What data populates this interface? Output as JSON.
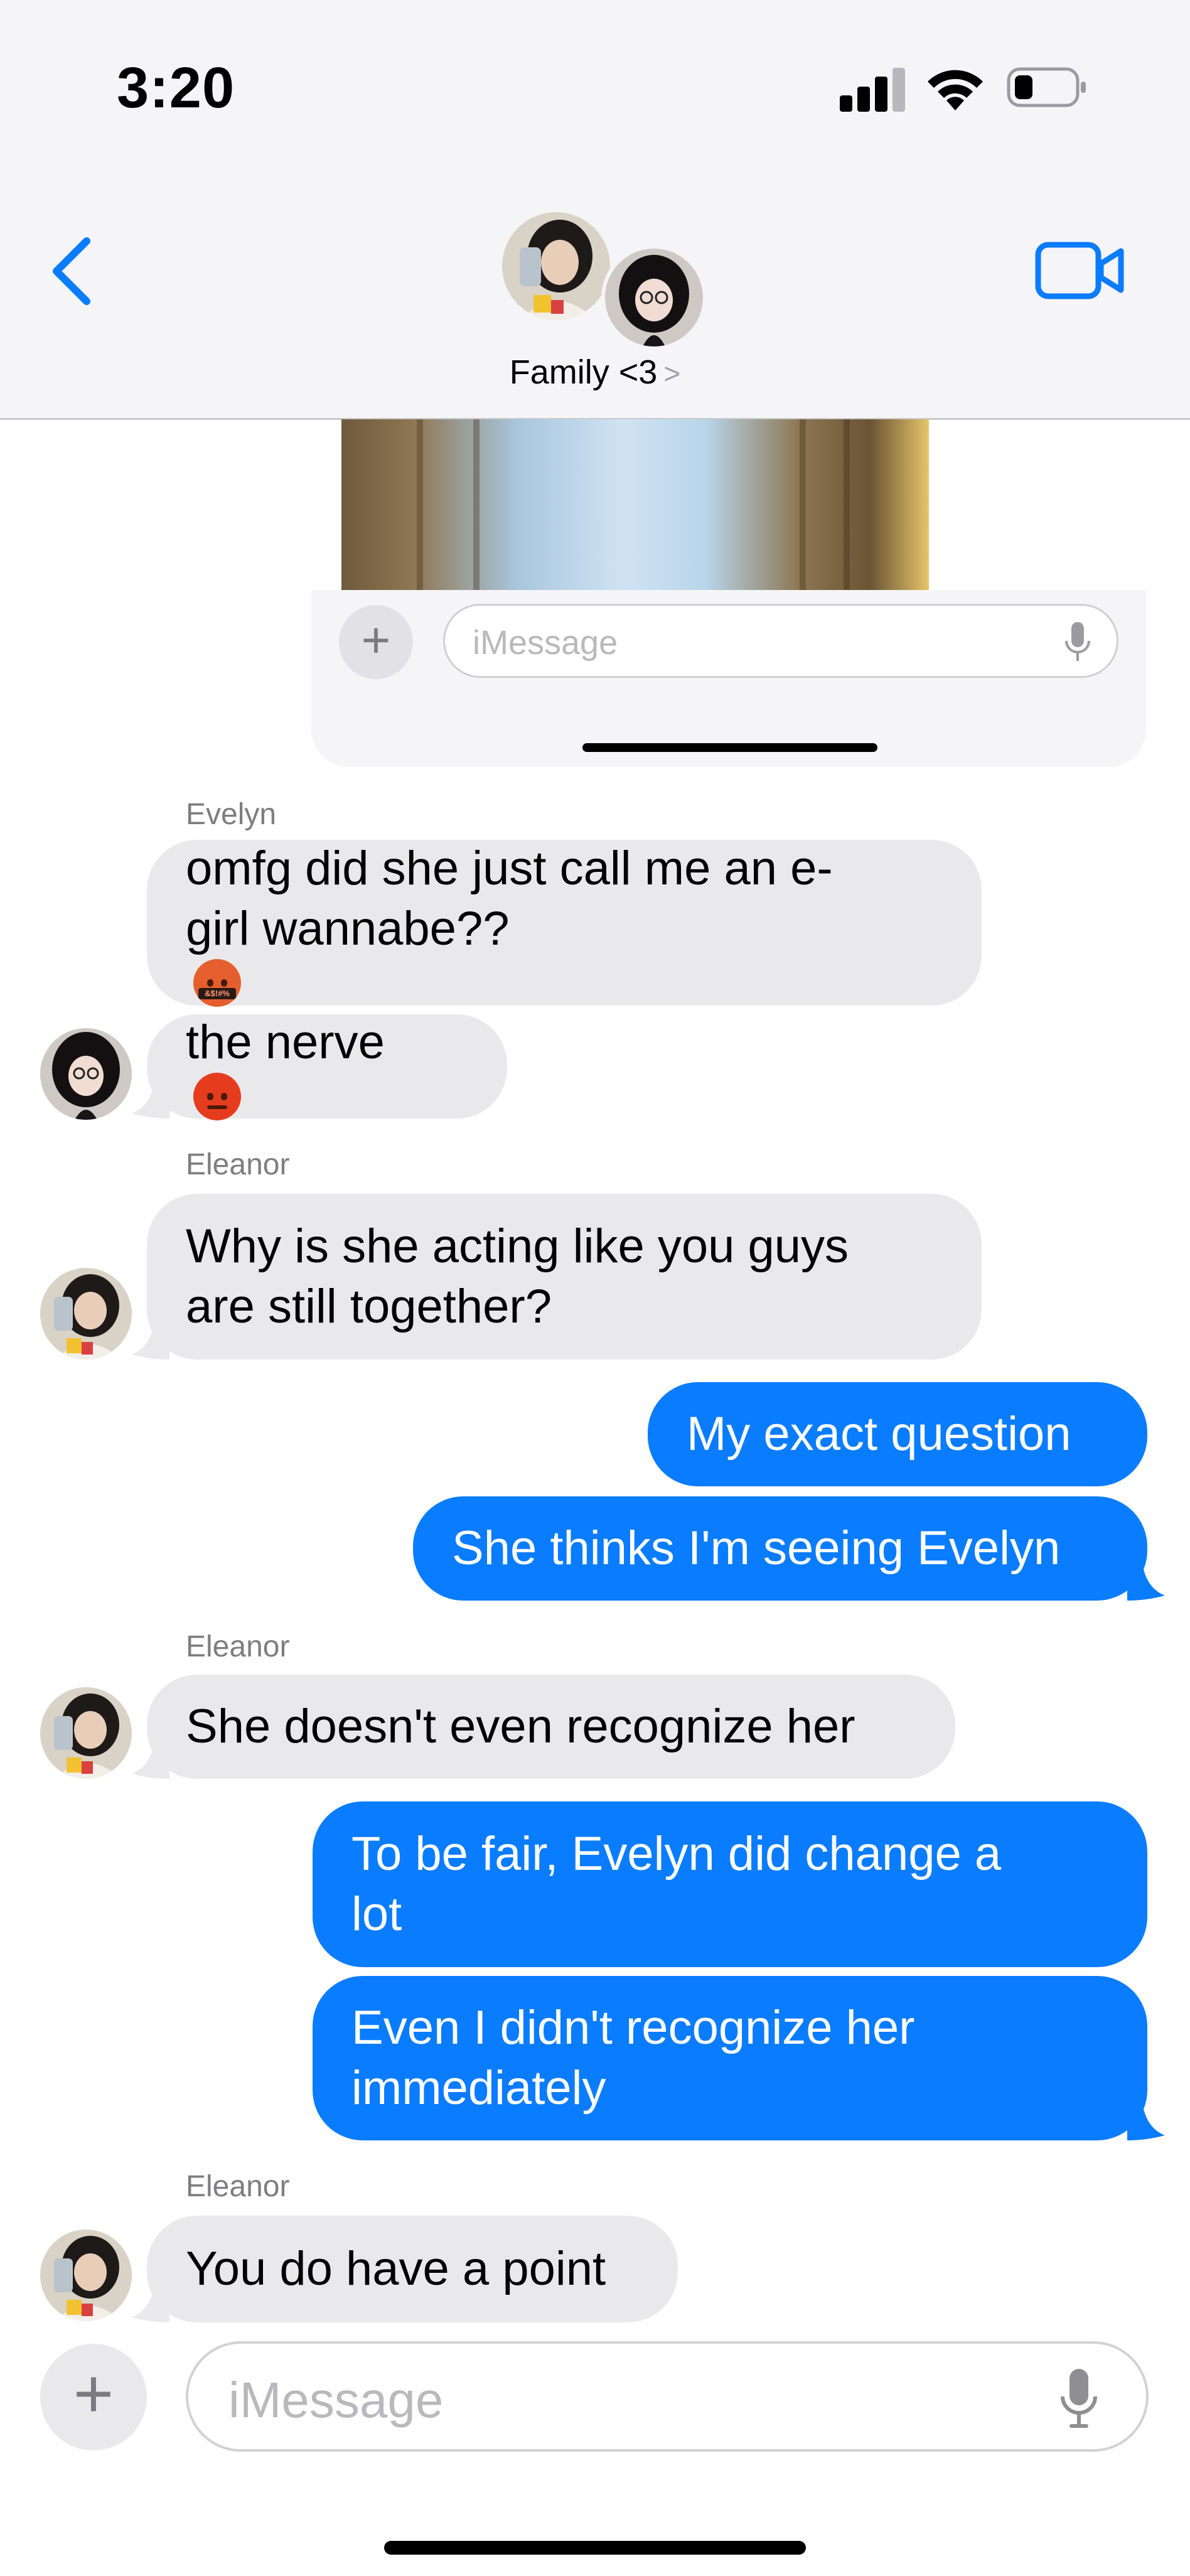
{
  "status_bar": {
    "time": "3:20"
  },
  "header": {
    "group_name": "Family <3",
    "chevron": ">"
  },
  "embedded_screenshot": {
    "input_placeholder": "iMessage"
  },
  "messages": [
    {
      "sender": "Evelyn"
    },
    {
      "text": "omfg did she just call me an e-",
      "text2": "girl wannabe??",
      "emoji": "face-with-symbols-on-mouth",
      "emoji_text": "&$!#%"
    },
    {
      "text": "the nerve",
      "emoji": "angry-face"
    },
    {
      "sender": "Eleanor"
    },
    {
      "text": "Why is she acting like you guys",
      "text2": "are still together?"
    },
    {
      "text": "My exact question"
    },
    {
      "text": "She thinks I'm seeing Evelyn"
    },
    {
      "sender": "Eleanor"
    },
    {
      "text": "She doesn't even recognize her"
    },
    {
      "text": "To be fair, Evelyn did change a",
      "text2": "lot"
    },
    {
      "text": "Even I didn't recognize her",
      "text2": "immediately"
    },
    {
      "sender": "Eleanor"
    },
    {
      "text": "You do have a point"
    }
  ],
  "composer": {
    "placeholder": "iMessage"
  },
  "colors": {
    "outgoing": "#0a7cff",
    "incoming": "#e9e9eb",
    "accent": "#0a7cff"
  }
}
